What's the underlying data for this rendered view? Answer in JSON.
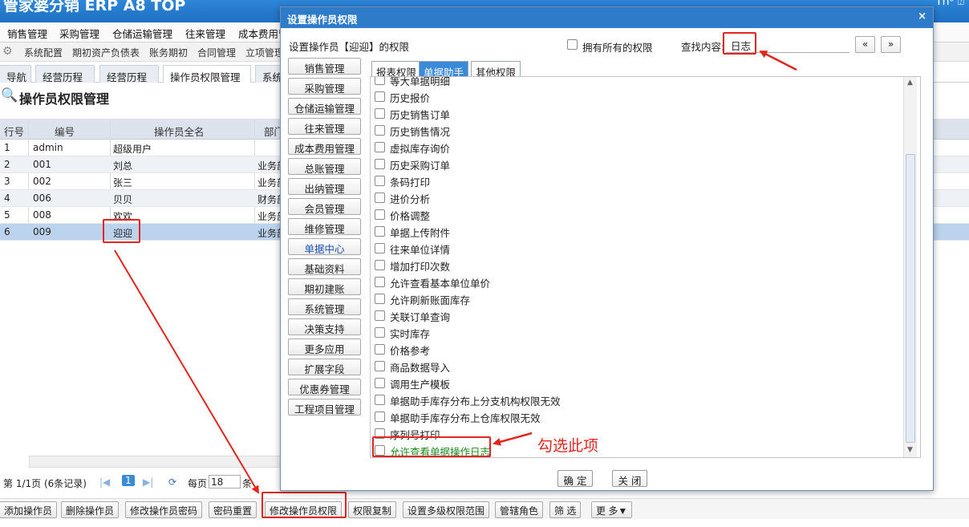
{
  "app": {
    "title": "管家婆分销 ERP A8 TOP",
    "top_icons": "Tn⁰ ⍰"
  },
  "menu": [
    "销售管理",
    "采购管理",
    "仓储运输管理",
    "往来管理",
    "成本费用管"
  ],
  "submenu": [
    "系统配置",
    "期初资产负债表",
    "账务期初",
    "合同管理",
    "立项管理"
  ],
  "page_tabs": [
    "导航",
    "经营历程",
    "经营历程",
    "操作员权限管理",
    "系统"
  ],
  "page_title": "操作员权限管理",
  "grid": {
    "headers": [
      "行号",
      "编号",
      "操作员全名",
      "部门"
    ],
    "rows": [
      {
        "n": "1",
        "code": "admin",
        "name": "超级用户",
        "dept": ""
      },
      {
        "n": "2",
        "code": "001",
        "name": "刘总",
        "dept": "业务部"
      },
      {
        "n": "3",
        "code": "002",
        "name": "张三",
        "dept": "业务部"
      },
      {
        "n": "4",
        "code": "006",
        "name": "贝贝",
        "dept": "财务部"
      },
      {
        "n": "5",
        "code": "008",
        "name": "欢欢",
        "dept": "业务部"
      },
      {
        "n": "6",
        "code": "009",
        "name": "迎迎",
        "dept": "业务部"
      }
    ]
  },
  "pager": {
    "info": "第 1/1页 (6条记录)",
    "page": "1",
    "per_page_label": "每页",
    "per_page": "18",
    "unit": "条"
  },
  "bottom_buttons": [
    "添加操作员",
    "删除操作员",
    "修改操作员密码",
    "密码重置",
    "修改操作员权限",
    "权限复制",
    "设置多级权限范围",
    "管辖角色",
    "筛 选",
    "更 多▼"
  ],
  "dialog": {
    "title": "设置操作员权限",
    "close": "×",
    "heading": "设置操作员【迎迎】的权限",
    "own_all_label": "拥有所有的权限",
    "search_label": "查找内容:",
    "search_value": "日志",
    "prev": "«",
    "next": "»",
    "modules": [
      "销售管理",
      "采购管理",
      "仓储运输管理",
      "往来管理",
      "成本费用管理",
      "总账管理",
      "出纳管理",
      "会员管理",
      "维修管理",
      "单据中心",
      "基础资料",
      "期初建账",
      "系统管理",
      "决策支持",
      "更多应用",
      "扩展字段",
      "优惠券管理",
      "工程项目管理"
    ],
    "tabs": [
      "报表权限",
      "单据助手",
      "其他权限"
    ],
    "permissions": [
      "等大单据明细",
      "历史报价",
      "历史销售订单",
      "历史销售情况",
      "虚拟库存询价",
      "历史采购订单",
      "条码打印",
      "进价分析",
      "价格调整",
      "单据上传附件",
      "往来单位详情",
      "增加打印次数",
      "允许查看基本单位单价",
      "允许刷新账面库存",
      "关联订单查询",
      "实时库存",
      "价格参考",
      "商品数据导入",
      "调用生产模板",
      "单据助手库存分布上分支机构权限无效",
      "单据助手库存分布上仓库权限无效",
      "序列号打印",
      "允许查看单据操作日志"
    ],
    "ok": "确 定",
    "cancel": "关 闭"
  },
  "annotation": "勾选此项",
  "colors": {
    "accent": "#2e7bc9",
    "highlight": "#e4251f",
    "green_text": "#1a8a1a"
  }
}
